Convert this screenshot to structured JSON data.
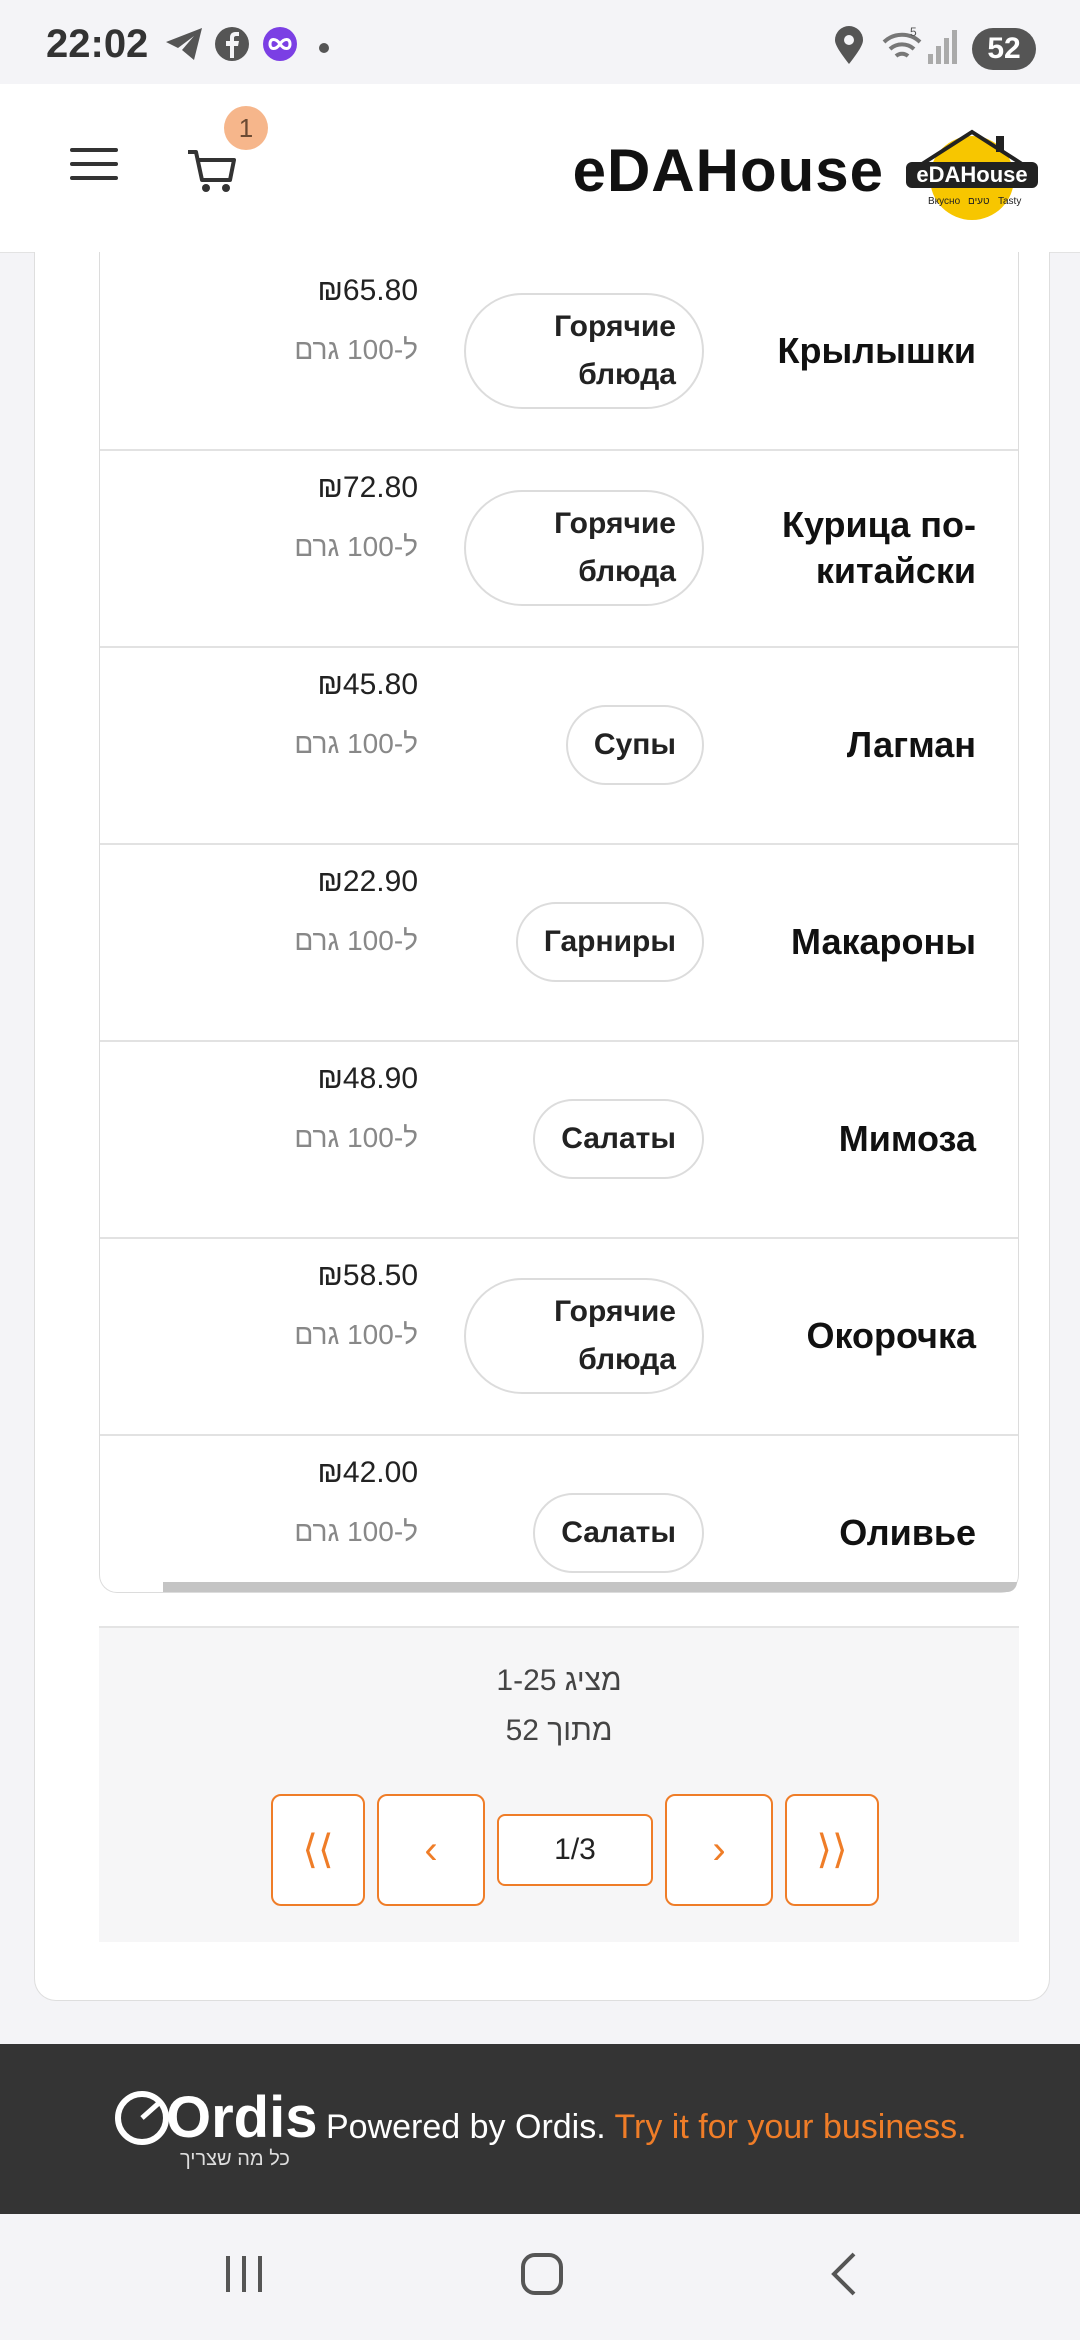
{
  "status_bar": {
    "time": "22:02",
    "battery": "52",
    "icons": [
      "telegram-icon",
      "facebook-icon",
      "messenger-icon",
      "dot-icon",
      "location-icon",
      "wifi-icon",
      "signal-icon"
    ]
  },
  "header": {
    "brand": "eDAHouse",
    "cart_count": "1",
    "logo": {
      "text": "eDAHouse",
      "sub_left": "Вкусно",
      "sub_mid": "טעים",
      "sub_right": "Tasty"
    }
  },
  "products": [
    {
      "name": "Крылышки",
      "category": "Горячие блюда",
      "price": "₪65.80",
      "unit": "ל-100 גרם"
    },
    {
      "name": "Курица по-китайски",
      "category": "Горячие блюда",
      "price": "₪72.80",
      "unit": "ל-100 גרם"
    },
    {
      "name": "Лагман",
      "category": "Супы",
      "price": "₪45.80",
      "unit": "ל-100 גרם"
    },
    {
      "name": "Макароны",
      "category": "Гарниры",
      "price": "₪22.90",
      "unit": "ל-100 גרם"
    },
    {
      "name": "Мимоза",
      "category": "Салаты",
      "price": "₪48.90",
      "unit": "ל-100 גרם"
    },
    {
      "name": "Окорочка",
      "category": "Горячие блюда",
      "price": "₪58.50",
      "unit": "ל-100 גרם"
    },
    {
      "name": "Оливье",
      "category": "Салаты",
      "price": "₪42.00",
      "unit": "ל-100 גרם"
    }
  ],
  "pagination": {
    "range": "מציג 1-25",
    "total": "מתוך 52",
    "page": "1/3",
    "first": "⟨⟨",
    "prev": "‹",
    "next": "›",
    "last": "⟩⟩"
  },
  "footer": {
    "logo": "Ordis",
    "logo_sub": "כל מה שצריך",
    "powered": "Powered by Ordis.",
    "cta": "Try it for your business."
  },
  "colors": {
    "accent": "#ef7d28",
    "footer_bg": "#343434",
    "badge": "#f6b68b"
  }
}
